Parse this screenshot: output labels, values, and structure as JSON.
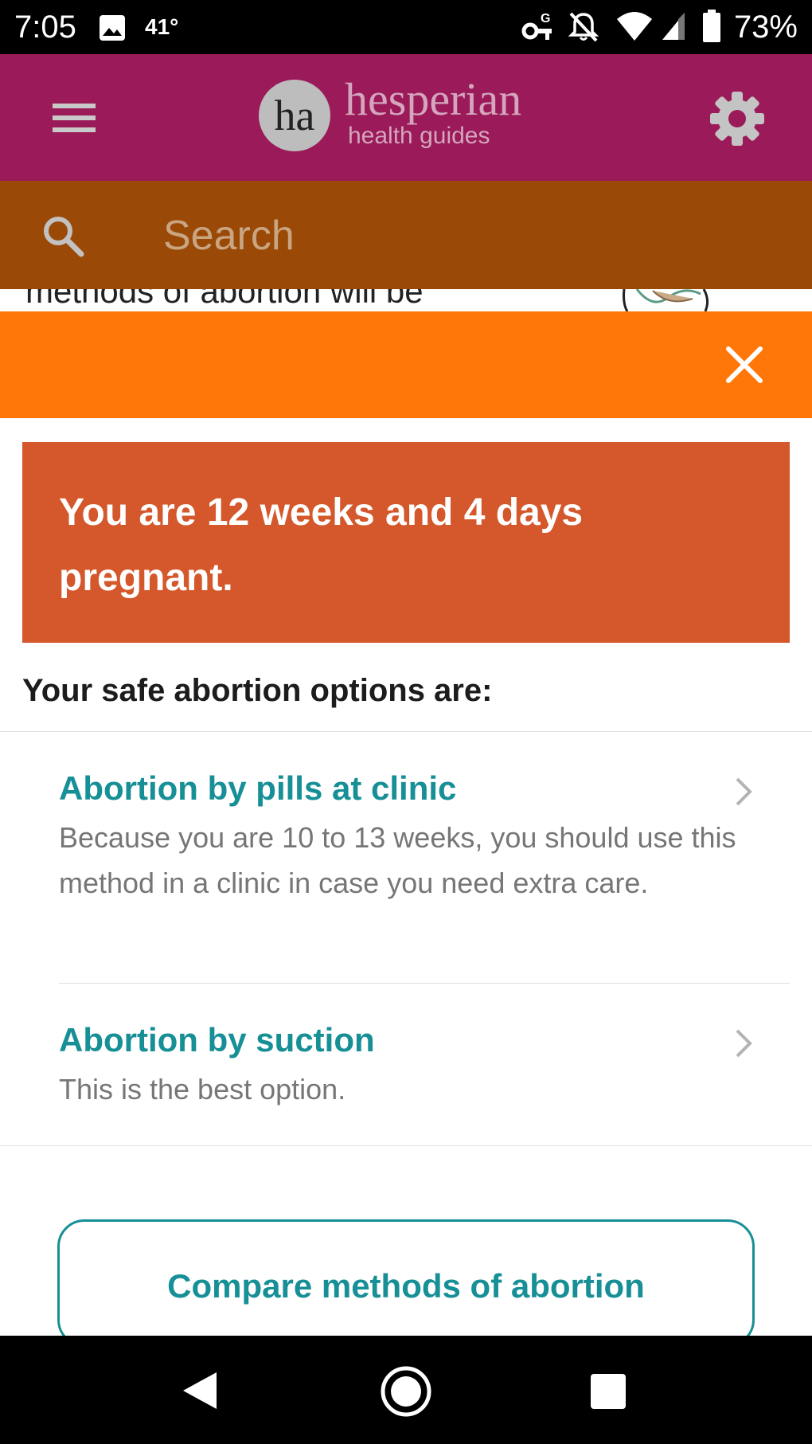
{
  "status_bar": {
    "time": "7:05",
    "temperature": "41°",
    "battery_percent": "73%",
    "icons": [
      "image-icon",
      "vpn-key-icon",
      "notifications-off-icon",
      "wifi-icon",
      "cell-signal-icon",
      "battery-icon"
    ]
  },
  "header": {
    "logo_letters": "ha",
    "brand_name": "hesperian",
    "brand_subtitle": "health guides",
    "menu_icon": "hamburger-menu-icon",
    "settings_icon": "gear-icon",
    "background_color": "#9b1a59"
  },
  "search": {
    "placeholder": "Search",
    "icon": "search-icon",
    "background_color": "#9a4a06"
  },
  "background_page": {
    "peek_text": "methods of abortion will be"
  },
  "close_bar": {
    "icon": "close-icon",
    "background_color": "#ff7609"
  },
  "result": {
    "alert_text": "You are 12 weeks and 4 days pregnant.",
    "alert_color": "#d4582b",
    "options_heading": "Your safe abortion options are:",
    "options": [
      {
        "title": "Abortion by pills at clinic",
        "description": "Because you are 10 to 13 weeks, you should use this method in a clinic in case you need extra care."
      },
      {
        "title": "Abortion by suction",
        "description": "This is the best option."
      }
    ],
    "compare_button": "Compare methods of abortion",
    "accent_color": "#178f96"
  },
  "nav_bar": {
    "icons": [
      "back-icon",
      "home-icon",
      "recents-icon"
    ]
  }
}
